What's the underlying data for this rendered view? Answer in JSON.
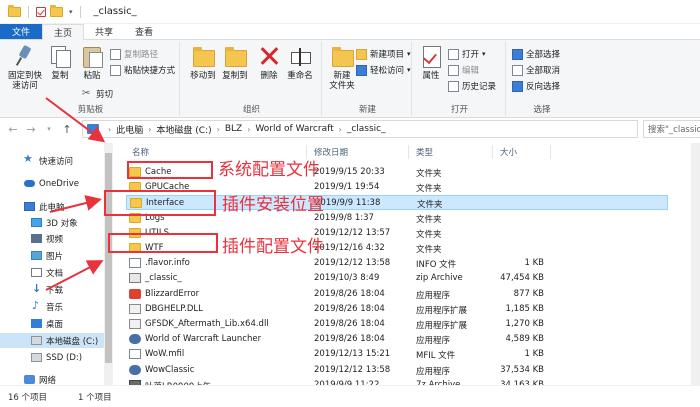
{
  "window": {
    "title": "_classic_"
  },
  "tabs": [
    "文件",
    "主页",
    "共享",
    "查看"
  ],
  "ribbon": {
    "clipboard": {
      "group_label": "剪贴板",
      "pin_label_1": "固定到快",
      "pin_label_2": "速访问",
      "copy_label": "复制",
      "paste_label": "粘贴",
      "copy_path": "复制路径",
      "paste_shortcut": "粘贴快捷方式",
      "cut": "剪切"
    },
    "organize": {
      "group_label": "组织",
      "move_to": "移动到",
      "copy_to": "复制到",
      "delete": "删除",
      "rename": "重命名"
    },
    "new": {
      "group_label": "新建",
      "new_folder_1": "新建",
      "new_folder_2": "文件夹",
      "new_item": "新建项目",
      "easy_access": "轻松访问"
    },
    "open": {
      "group_label": "打开",
      "properties": "属性",
      "open": "打开",
      "edit": "编辑",
      "history": "历史记录"
    },
    "select": {
      "group_label": "选择",
      "select_all": "全部选择",
      "select_none": "全部取消",
      "invert": "反向选择"
    }
  },
  "address": {
    "crumbs": [
      "此电脑",
      "本地磁盘 (C:)",
      "BLZ",
      "World of Warcraft",
      "_classic_"
    ],
    "search_placeholder": "搜索\"_classic_\""
  },
  "nav_pane": {
    "items": [
      {
        "label": "快速访问",
        "icon": "star-icon"
      },
      {
        "label": "OneDrive",
        "icon": "cloud-icon"
      },
      {
        "label": "此电脑",
        "icon": "pc-icon"
      },
      {
        "label": "3D 对象",
        "icon": "cube-icon"
      },
      {
        "label": "视频",
        "icon": "video-icon"
      },
      {
        "label": "图片",
        "icon": "picture-icon"
      },
      {
        "label": "文档",
        "icon": "document-icon"
      },
      {
        "label": "下载",
        "icon": "download-icon"
      },
      {
        "label": "音乐",
        "icon": "music-icon"
      },
      {
        "label": "桌面",
        "icon": "desktop-icon"
      },
      {
        "label": "本地磁盘 (C:)",
        "icon": "drive-icon"
      },
      {
        "label": "SSD (D:)",
        "icon": "drive-icon"
      },
      {
        "label": "网络",
        "icon": "network-icon"
      }
    ]
  },
  "file_list": {
    "columns": [
      "名称",
      "修改日期",
      "类型",
      "大小"
    ],
    "rows": [
      {
        "name": "Cache",
        "date": "2019/9/15 20:33",
        "type": "文件夹",
        "size": "",
        "icon": "folder-icon"
      },
      {
        "name": "GPUCache",
        "date": "2019/9/1 19:54",
        "type": "文件夹",
        "size": "",
        "icon": "folder-icon"
      },
      {
        "name": "Interface",
        "date": "2019/9/9 11:38",
        "type": "文件夹",
        "size": "",
        "icon": "folder-icon"
      },
      {
        "name": "Logs",
        "date": "2019/9/8 1:37",
        "type": "文件夹",
        "size": "",
        "icon": "folder-icon"
      },
      {
        "name": "UTILS",
        "date": "2019/12/12 13:57",
        "type": "文件夹",
        "size": "",
        "icon": "folder-icon"
      },
      {
        "name": "WTF",
        "date": "2019/12/16 4:32",
        "type": "文件夹",
        "size": "",
        "icon": "folder-icon"
      },
      {
        "name": ".flavor.info",
        "date": "2019/12/12 13:58",
        "type": "INFO 文件",
        "size": "1 KB",
        "icon": "document-icon"
      },
      {
        "name": "_classic_",
        "date": "2019/10/3 8:49",
        "type": "zip Archive",
        "size": "47,454 KB",
        "icon": "zip-icon"
      },
      {
        "name": "BlizzardError",
        "date": "2019/8/26 18:04",
        "type": "应用程序",
        "size": "877 KB",
        "icon": "app-icon"
      },
      {
        "name": "DBGHELP.DLL",
        "date": "2019/8/26 18:04",
        "type": "应用程序扩展",
        "size": "1,185 KB",
        "icon": "dll-icon"
      },
      {
        "name": "GFSDK_Aftermath_Lib.x64.dll",
        "date": "2019/8/26 18:04",
        "type": "应用程序扩展",
        "size": "1,270 KB",
        "icon": "dll-icon"
      },
      {
        "name": "World of Warcraft Launcher",
        "date": "2019/8/26 18:04",
        "type": "应用程序",
        "size": "4,589 KB",
        "icon": "wow-icon"
      },
      {
        "name": "WoW.mfil",
        "date": "2019/12/13 15:21",
        "type": "MFIL 文件",
        "size": "1 KB",
        "icon": "document-icon"
      },
      {
        "name": "WowClassic",
        "date": "2019/12/12 13:58",
        "type": "应用程序",
        "size": "37,534 KB",
        "icon": "wow-icon"
      },
      {
        "name": "叶落LR0909上午",
        "date": "2019/9/9 11:22",
        "type": "7z Archive",
        "size": "34,163 KB",
        "icon": "archive-icon"
      }
    ]
  },
  "annotations": {
    "config": "系统配置文件",
    "addon_install": "插件安装位置",
    "addon_config": "插件配置文件",
    "color": "#e8323c"
  },
  "status": {
    "count": "16 个项目",
    "selected": "1 个项目"
  }
}
